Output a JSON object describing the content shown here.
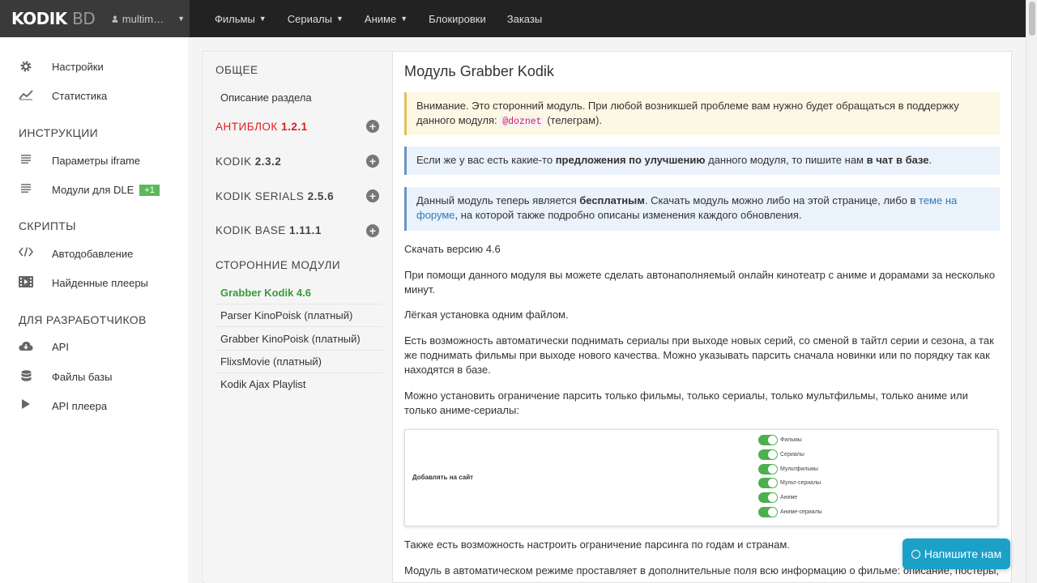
{
  "brand": {
    "logo_main": "KODIK",
    "logo_sub": "BD",
    "user": "multim…"
  },
  "nav": {
    "films": "Фильмы",
    "serials": "Сериалы",
    "anime": "Аниме",
    "blocks": "Блокировки",
    "orders": "Заказы"
  },
  "sidebar": {
    "settings": "Настройки",
    "stats": "Статистика",
    "instructions_head": "ИНСТРУКЦИИ",
    "iframe": "Параметры iframe",
    "dle": "Модули для DLE",
    "dle_badge": "+1",
    "scripts_head": "СКРИПТЫ",
    "autoadd": "Автодобавление",
    "players": "Найденные плееры",
    "dev_head": "ДЛЯ РАЗРАБОТЧИКОВ",
    "api": "API",
    "dbfiles": "Файлы базы",
    "playerapi": "API плеера"
  },
  "subnav": {
    "general_head": "ОБЩЕЕ",
    "desc": "Описание раздела",
    "antiblock_name": "АНТИБЛОК",
    "antiblock_ver": "1.2.1",
    "kodik_name": "KODIK",
    "kodik_ver": "2.3.2",
    "serials_name": "KODIK SERIALS",
    "serials_ver": "2.5.6",
    "base_name": "KODIK BASE",
    "base_ver": "1.11.1",
    "third_head": "СТОРОННИЕ МОДУЛИ",
    "modules": [
      "Grabber Kodik 4.6",
      "Parser KinoPoisk (платный)",
      "Grabber KinoPoisk (платный)",
      "FlixsMovie (платный)",
      "Kodik Ajax Playlist"
    ]
  },
  "main": {
    "title": "Модуль Grabber Kodik",
    "warn_text1": "Внимание. Это сторонний модуль. При любой возникшей проблеме вам нужно будет обращаться в поддержку данного модуля:",
    "warn_code": "@doznet",
    "warn_text2": "(телеграм).",
    "info1_a": "Если же у вас есть какие-то",
    "info1_b": "предложения по улучшению",
    "info1_c": "данного модуля, то пишите нам",
    "info1_d": "в чат в базе",
    "info1_e": ".",
    "info2_a": "Данный модуль теперь является",
    "info2_b": "бесплатным",
    "info2_c": ". Скачать модуль можно либо на этой странице, либо в",
    "info2_link": "теме на форуме",
    "info2_d": ", на которой также подробно описаны изменения каждого обновления.",
    "download": "Скачать версию 4.6",
    "p1": "При помощи данного модуля вы можете сделать автонаполняемый онлайн кинотеатр с аниме и дорамами за несколько минут.",
    "p2": "Лёгкая установка одним файлом.",
    "p3": "Есть возможность автоматически поднимать сериалы при выходе новых серий, со сменой в тайтл серии и сезона, а так же поднимать фильмы при выходе нового качества. Можно указывать парсить сначала новинки или по порядку так как находятся в базе.",
    "p4": "Можно установить ограничение парсить только фильмы, только сериалы, только мультфильмы, только аниме или только аниме-сериалы:",
    "shot_label": "Добавлять на сайт",
    "toggles": [
      "Фильмы",
      "Сериалы",
      "Мультфильмы",
      "Мульт-сериалы",
      "Аниме",
      "Аниме-сериалы"
    ],
    "p5": "Также есть возможность настроить ограничение парсинга по годам и странам.",
    "p6": "Модуль в автоматическом режиме проставляет в дополнительные поля всю информацию о фильме: описание, постеры,"
  },
  "chat": {
    "label": "Напишите нам"
  }
}
